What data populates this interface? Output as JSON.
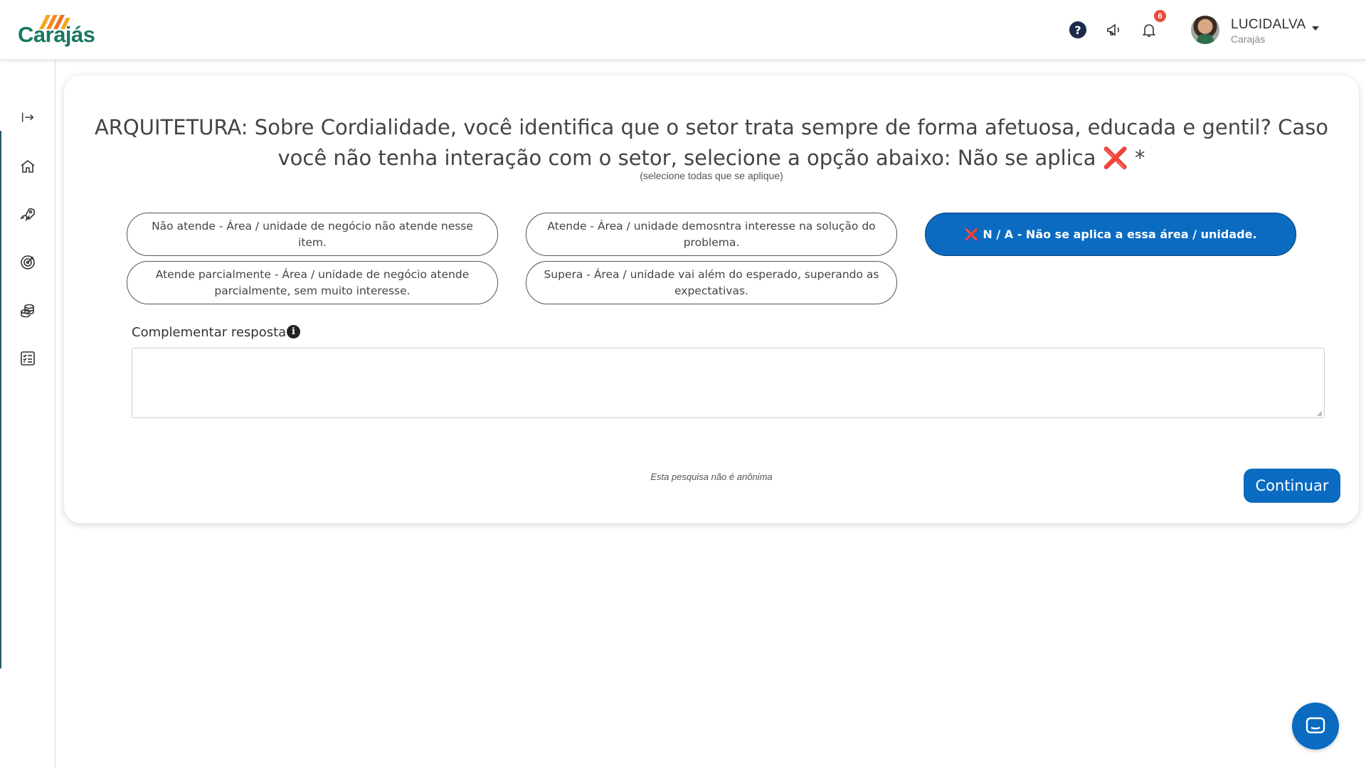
{
  "brand": {
    "name": "Carajás",
    "color": "#1a7863",
    "accent": "#0a6bc1"
  },
  "header": {
    "notifications_count": "6",
    "user": {
      "name": "LUCIDALVA",
      "org": "Carajás"
    },
    "icons": [
      "help-icon",
      "megaphone-icon",
      "bell-icon",
      "chevron-down-icon"
    ]
  },
  "sidebar": {
    "icons": [
      "expand-sidebar-icon",
      "home-icon",
      "rocket-icon",
      "target-icon",
      "coins-icon",
      "checklist-icon"
    ]
  },
  "survey": {
    "question": "ARQUITETURA: Sobre Cordialidade, você identifica que o setor trata sempre de forma afetuosa, educada e gentil? Caso você não tenha interação com o setor, selecione a opção abaixo: Não se aplica",
    "question_mark": "❌",
    "required_mark": "*",
    "hint": "(selecione todas que se aplique)",
    "options": [
      {
        "label": "Não atende - Área / unidade de negócio não atende nesse item.",
        "selected": false
      },
      {
        "label": "Atende - Área / unidade demosntra interesse na solução do problema.",
        "selected": false
      },
      {
        "label": "N / A - Não se aplica a essa área / unidade.",
        "mark": "❌",
        "selected": true
      },
      {
        "label": "Atende parcialmente - Área / unidade de negócio atende parcialmente, sem muito interesse.",
        "selected": false
      },
      {
        "label": "Supera - Área / unidade vai além do esperado, superando as expectativas.",
        "selected": false
      }
    ],
    "complement_label": "Complementar resposta",
    "complement_value": "",
    "anonymous_note": "Esta pesquisa não é anônima",
    "continue_label": "Continuar"
  }
}
